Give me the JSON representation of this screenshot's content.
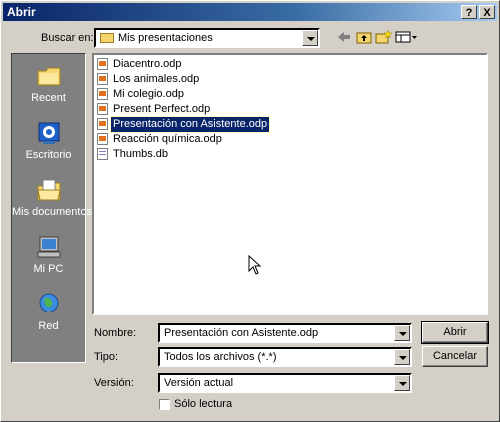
{
  "window": {
    "title": "Abrir"
  },
  "title_buttons": {
    "help": "?",
    "close": "X"
  },
  "look_in": {
    "label": "Buscar en:",
    "value": "Mis presentaciones"
  },
  "places": [
    {
      "label": "Recent",
      "icon": "recent-folder-icon"
    },
    {
      "label": "Escritorio",
      "icon": "desktop-icon"
    },
    {
      "label": "Mis documentos",
      "icon": "my-documents-icon"
    },
    {
      "label": "Mi PC",
      "icon": "my-computer-icon"
    },
    {
      "label": "Red",
      "icon": "network-icon"
    }
  ],
  "files": [
    {
      "name": "Diacentro.odp",
      "icon": "presentation-file-icon"
    },
    {
      "name": "Los animales.odp",
      "icon": "presentation-file-icon"
    },
    {
      "name": "Mi colegio.odp",
      "icon": "presentation-file-icon"
    },
    {
      "name": "Present Perfect.odp",
      "icon": "presentation-file-icon"
    },
    {
      "name": "Presentación con Asistente.odp",
      "icon": "presentation-file-icon",
      "selected": true
    },
    {
      "name": "Reacción química.odp",
      "icon": "presentation-file-icon"
    },
    {
      "name": "Thumbs.db",
      "icon": "database-file-icon"
    }
  ],
  "form": {
    "name_label": "Nombre:",
    "name_value": "Presentación con Asistente.odp",
    "type_label": "Tipo:",
    "type_value": "Todos los archivos (*.*)",
    "version_label": "Versión:",
    "version_value": "Versión actual",
    "readonly_label": "Sólo lectura"
  },
  "buttons": {
    "open": "Abrir",
    "cancel": "Cancelar"
  },
  "colors": {
    "titlebar": "#0a246a",
    "selection": "#0a246a",
    "face": "#d4d0c8",
    "sidebar": "#808080"
  }
}
